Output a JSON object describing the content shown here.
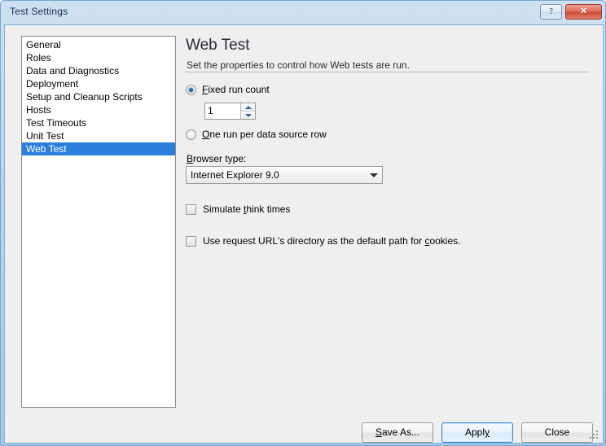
{
  "window": {
    "title": "Test Settings",
    "help_button_label": "?",
    "close_button_label": "✕",
    "frame_color": "#6fa8d4",
    "titlebar_gradient_top": "#cfe0f2",
    "titlebar_gradient_bottom": "#a9c8e4"
  },
  "sidebar": {
    "items": [
      {
        "label": "General",
        "selected": false
      },
      {
        "label": "Roles",
        "selected": false
      },
      {
        "label": "Data and Diagnostics",
        "selected": false
      },
      {
        "label": "Deployment",
        "selected": false
      },
      {
        "label": "Setup and Cleanup Scripts",
        "selected": false
      },
      {
        "label": "Hosts",
        "selected": false
      },
      {
        "label": "Test Timeouts",
        "selected": false
      },
      {
        "label": "Unit Test",
        "selected": false
      },
      {
        "label": "Web Test",
        "selected": true
      }
    ],
    "selection_color": "#2a7fdd"
  },
  "pane": {
    "title": "Web Test",
    "subtitle": "Set the properties to control how Web tests are run.",
    "run_mode": {
      "fixed_run_count": {
        "label_before": "F",
        "label_after": "ixed run count",
        "checked": true
      },
      "one_run_per_data_source_row": {
        "label_before": "O",
        "label_after": "ne run per data source row",
        "checked": false
      },
      "run_count_value": "1"
    },
    "browser": {
      "label_before": "B",
      "label_after": "rowser type:",
      "selected_option": "Internet Explorer 9.0"
    },
    "options": [
      {
        "pre": "Simulate ",
        "accel": "t",
        "post": "hink times",
        "checked": false
      },
      {
        "pre": "Use request URL's directory as the default path for ",
        "accel": "c",
        "post": "ookies.",
        "checked": false
      }
    ]
  },
  "footer": {
    "save_as": {
      "accel": "S",
      "rest": "ave As..."
    },
    "apply": {
      "pre": "Appl",
      "accel": "y",
      "post": ""
    },
    "close": {
      "label": "Close"
    }
  }
}
